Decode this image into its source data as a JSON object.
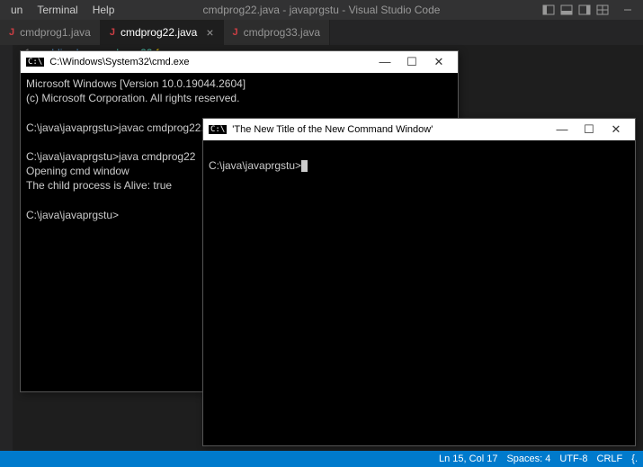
{
  "menubar": {
    "items": [
      "un",
      "Terminal",
      "Help"
    ]
  },
  "window_title": "cmdprog22.java - javaprgstu - Visual Studio Code",
  "tabs": [
    {
      "label": "cmdprog1.java",
      "active": false,
      "close": false
    },
    {
      "label": "cmdprog22.java",
      "active": true,
      "close": true
    },
    {
      "label": "cmdprog33.java",
      "active": false,
      "close": false
    }
  ],
  "editor": {
    "lineno": "1",
    "tokens": {
      "public": "public",
      "class": "class",
      "name": "cmdprog22",
      "brace": "{"
    }
  },
  "cmd1": {
    "title": "C:\\Windows\\System32\\cmd.exe",
    "lines": [
      "Microsoft Windows [Version 10.0.19044.2604]",
      "(c) Microsoft Corporation. All rights reserved.",
      "",
      "C:\\java\\javaprgstu>javac cmdprog22.java",
      "",
      "C:\\java\\javaprgstu>java cmdprog22",
      "Opening cmd window",
      "The child process is Alive: true",
      "",
      "C:\\java\\javaprgstu>"
    ]
  },
  "cmd2": {
    "title": "'The New Title of the New Command Window'",
    "lines": [
      "",
      "C:\\java\\javaprgstu>"
    ]
  },
  "statusbar": {
    "lncol": "Ln 15, Col 17",
    "spaces": "Spaces: 4",
    "enc": "UTF-8",
    "eol": "CRLF",
    "lang": "{."
  },
  "glyphs": {
    "min": "—",
    "max": "☐",
    "close": "✕",
    "tabclose": "×"
  }
}
